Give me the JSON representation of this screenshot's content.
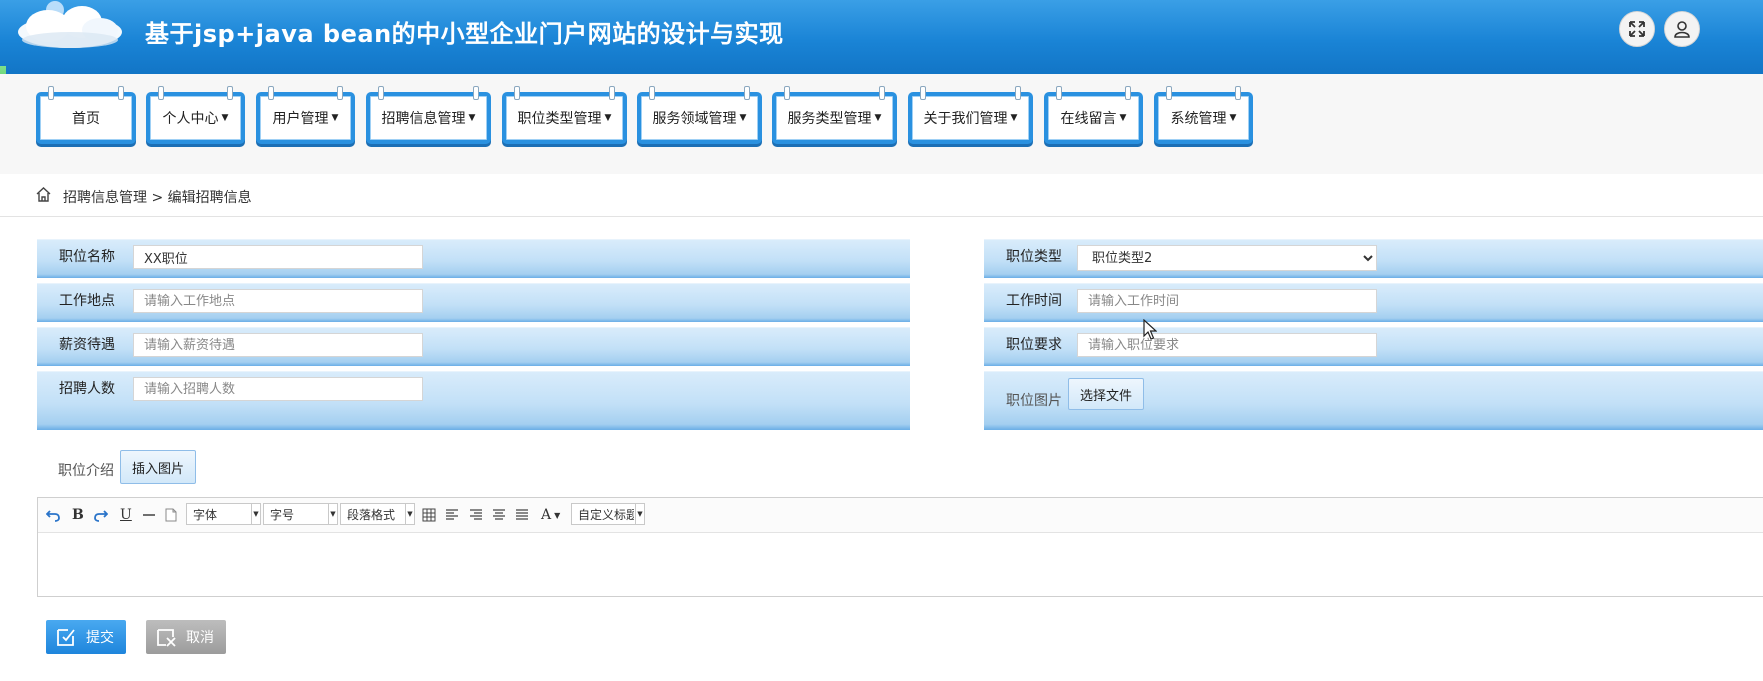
{
  "header": {
    "title": "基于jsp+java bean的中小型企业门户网站的设计与实现",
    "fullscreen_icon": "fullscreen-icon",
    "user_icon": "user-icon"
  },
  "nav": {
    "items": [
      {
        "label": "首页",
        "has_dropdown": false
      },
      {
        "label": "个人中心",
        "has_dropdown": true
      },
      {
        "label": "用户管理",
        "has_dropdown": true
      },
      {
        "label": "招聘信息管理",
        "has_dropdown": true
      },
      {
        "label": "职位类型管理",
        "has_dropdown": true
      },
      {
        "label": "服务领域管理",
        "has_dropdown": true
      },
      {
        "label": "服务类型管理",
        "has_dropdown": true
      },
      {
        "label": "关于我们管理",
        "has_dropdown": true
      },
      {
        "label": "在线留言",
        "has_dropdown": true
      },
      {
        "label": "系统管理",
        "has_dropdown": true
      }
    ],
    "caret": "▼"
  },
  "breadcrumb": {
    "home_icon": "home-icon",
    "text": "招聘信息管理 > 编辑招聘信息"
  },
  "form": {
    "position_name": {
      "label": "职位名称",
      "value": "XX职位"
    },
    "position_type": {
      "label": "职位类型",
      "value": "职位类型2"
    },
    "work_location": {
      "label": "工作地点",
      "placeholder": "请输入工作地点"
    },
    "work_time": {
      "label": "工作时间",
      "placeholder": "请输入工作时间"
    },
    "salary": {
      "label": "薪资待遇",
      "placeholder": "请输入薪资待遇"
    },
    "requirements": {
      "label": "职位要求",
      "placeholder": "请输入职位要求"
    },
    "headcount": {
      "label": "招聘人数",
      "placeholder": "请输入招聘人数"
    },
    "image": {
      "label": "职位图片",
      "button": "选择文件"
    },
    "intro": {
      "label": "职位介绍",
      "insert_button": "插入图片"
    }
  },
  "editor": {
    "font_select": "字体",
    "size_select": "字号",
    "paragraph_select": "段落格式",
    "custom_title_select": "自定义标题",
    "bold": "B",
    "underline": "U",
    "font_color": "A"
  },
  "actions": {
    "submit": "提交",
    "cancel": "取消"
  },
  "colors": {
    "header_blue": "#1a84d6",
    "nav_border": "#2a91e0",
    "submit_blue": "#2b95e8",
    "cancel_gray": "#a9a9a9"
  }
}
